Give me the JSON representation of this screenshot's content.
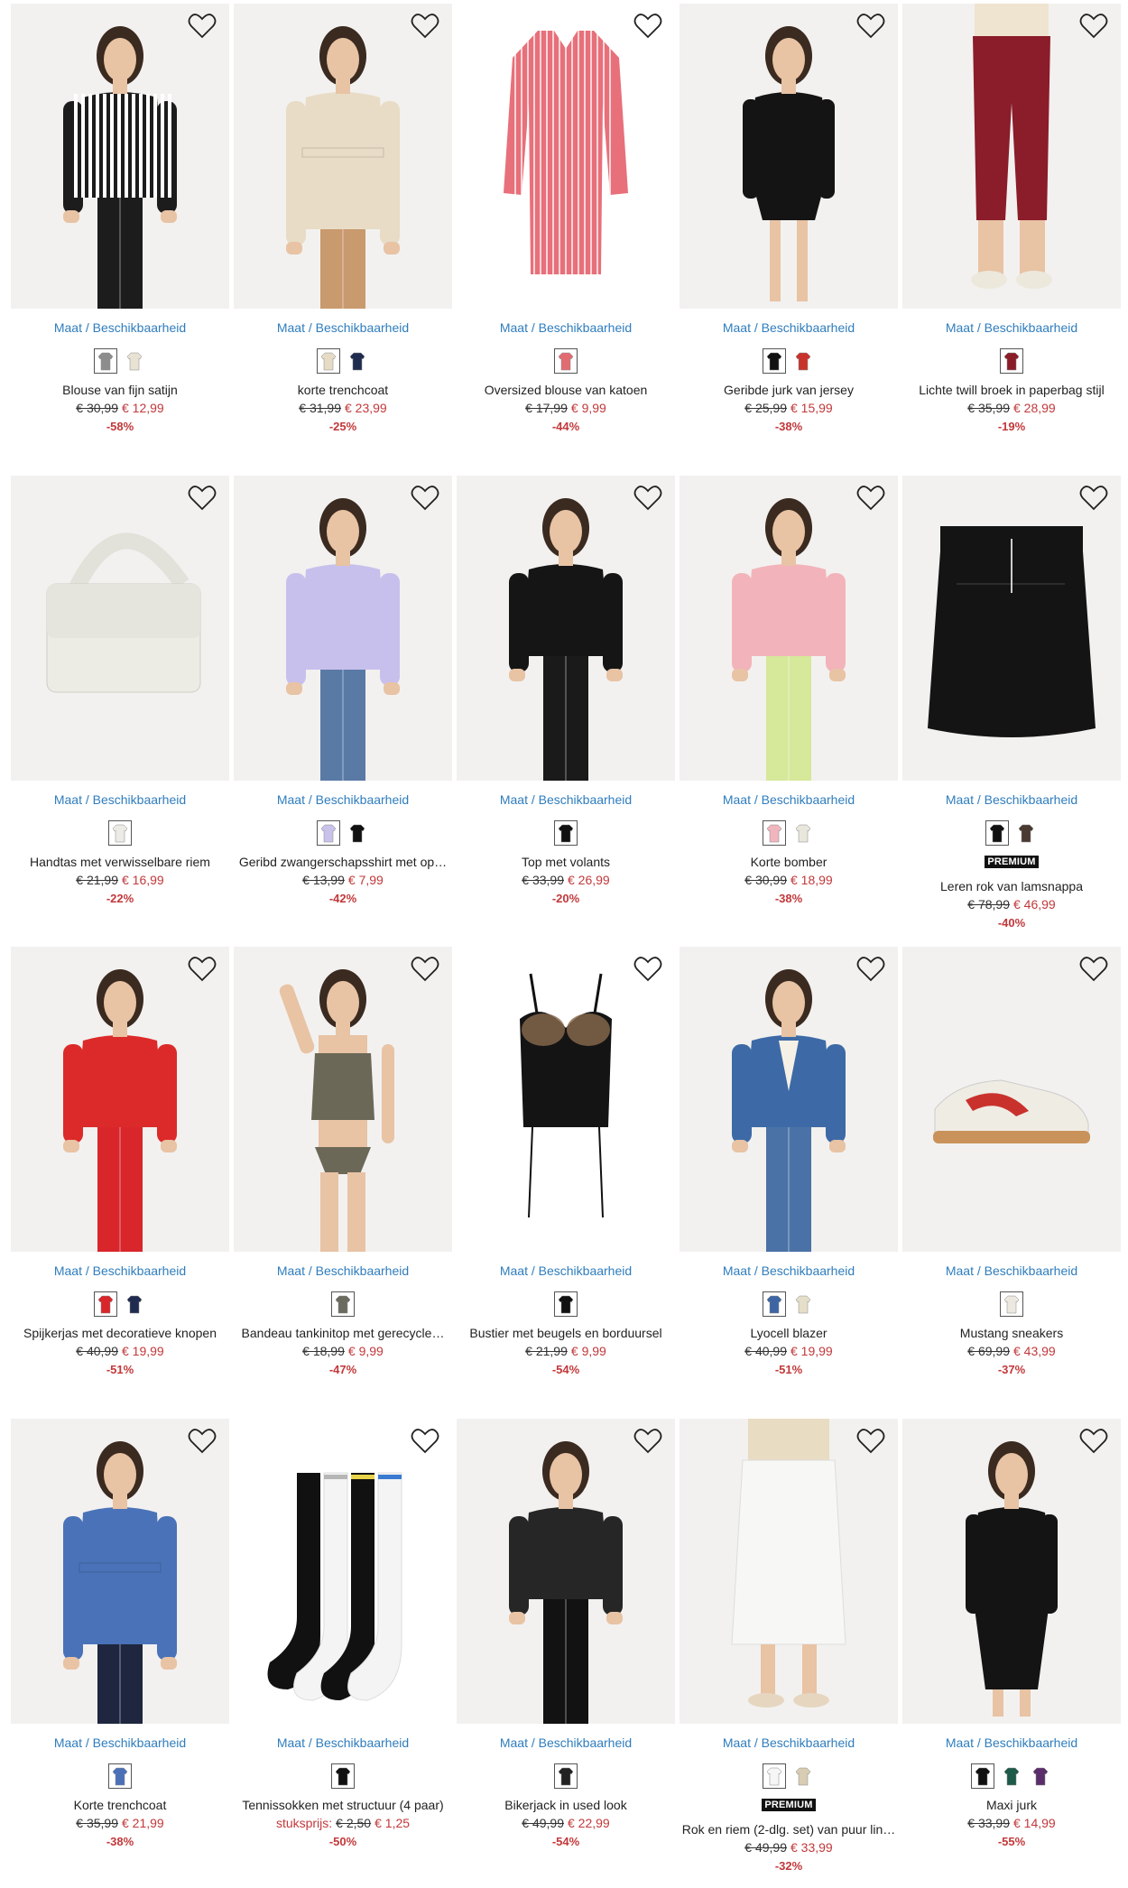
{
  "size_link_label": "Maat / Beschikbaarheid",
  "colors": {
    "link": "#2f7dbd",
    "sale": "#c2383a",
    "badge_bg": "#111111",
    "photo_bg": "#f2f1ef"
  },
  "rows": [
    {
      "products": [
        {
          "name": "Blouse van fijn satijn",
          "old_price": "€ 30,99",
          "new_price": "€ 12,99",
          "discount": "-58%",
          "swatches": [
            {
              "color": "#8d8d8d",
              "selected": true
            },
            {
              "color": "#e7e2d3",
              "selected": false
            }
          ],
          "image": {
            "type": "person",
            "garment": "blouse-striped",
            "top": "#1c1c1c",
            "bottom": "#1c1c1c",
            "bg": "#f2f1ef"
          }
        },
        {
          "name": "korte trenchcoat",
          "old_price": "€ 31,99",
          "new_price": "€ 23,99",
          "discount": "-25%",
          "swatches": [
            {
              "color": "#e6dcc6",
              "selected": true
            },
            {
              "color": "#1f2c4f",
              "selected": false
            }
          ],
          "image": {
            "type": "person",
            "garment": "coat",
            "top": "#e8dcc6",
            "bottom": "#c89a6e",
            "bg": "#f2f1ef"
          }
        },
        {
          "name": "Oversized blouse van katoen",
          "old_price": "€ 17,99",
          "new_price": "€ 9,99",
          "discount": "-44%",
          "swatches": [
            {
              "color": "#e26b72",
              "selected": true
            }
          ],
          "image": {
            "type": "shirt",
            "top": "#e7707a",
            "bg": "#ffffff"
          }
        },
        {
          "name": "Geribde jurk van jersey",
          "old_price": "€ 25,99",
          "new_price": "€ 15,99",
          "discount": "-38%",
          "swatches": [
            {
              "color": "#111111",
              "selected": true
            },
            {
              "color": "#c9322c",
              "selected": false
            }
          ],
          "image": {
            "type": "person",
            "garment": "dress",
            "top": "#141414",
            "bottom": "#141414",
            "bg": "#f2f1ef"
          }
        },
        {
          "name": "Lichte twill broek in paperbag stijl",
          "old_price": "€ 35,99",
          "new_price": "€ 28,99",
          "discount": "-19%",
          "swatches": [
            {
              "color": "#8b1d28",
              "selected": true
            }
          ],
          "image": {
            "type": "legs",
            "bottom": "#8b1c2a",
            "bg": "#f2f1ef"
          }
        }
      ]
    },
    {
      "products": [
        {
          "name": "Handtas met verwisselbare riem",
          "old_price": "€ 21,99",
          "new_price": "€ 16,99",
          "discount": "-22%",
          "swatches": [
            {
              "color": "#ecebe6",
              "selected": true
            }
          ],
          "image": {
            "type": "bag",
            "top": "#ecebe4",
            "bg": "#f2f1ef"
          }
        },
        {
          "name": "Geribd zwangerschapsshirt met op…",
          "old_price": "€ 13,99",
          "new_price": "€ 7,99",
          "discount": "-42%",
          "swatches": [
            {
              "color": "#c9c2ea",
              "selected": true
            },
            {
              "color": "#111111",
              "selected": false
            }
          ],
          "image": {
            "type": "person",
            "garment": "top-long",
            "top": "#c8c0ec",
            "bottom": "#5a7aa6",
            "bg": "#f2f1ef"
          }
        },
        {
          "name": "Top met volants",
          "old_price": "€ 33,99",
          "new_price": "€ 26,99",
          "discount": "-20%",
          "swatches": [
            {
              "color": "#111111",
              "selected": true
            }
          ],
          "image": {
            "type": "person",
            "garment": "top",
            "top": "#151515",
            "bottom": "#1a1a1a",
            "bg": "#f2f1ef"
          }
        },
        {
          "name": "Korte bomber",
          "old_price": "€ 30,99",
          "new_price": "€ 18,99",
          "discount": "-38%",
          "swatches": [
            {
              "color": "#f1b5bd",
              "selected": true
            },
            {
              "color": "#e9e6dc",
              "selected": false
            }
          ],
          "image": {
            "type": "person",
            "garment": "jacket",
            "top": "#f3b3ba",
            "bottom": "#d6e89a",
            "bg": "#f2f1ef"
          }
        },
        {
          "name": "Leren rok van lamsnappa",
          "old_price": "€ 78,99",
          "new_price": "€ 46,99",
          "discount": "-40%",
          "badge": "PREMIUM",
          "swatches": [
            {
              "color": "#111111",
              "selected": true
            },
            {
              "color": "#4a3a32",
              "selected": false
            }
          ],
          "image": {
            "type": "skirt",
            "bottom": "#141414",
            "bg": "#f2f1ef"
          }
        }
      ]
    },
    {
      "products": [
        {
          "name": "Spijkerjas met decoratieve knopen",
          "old_price": "€ 40,99",
          "new_price": "€ 19,99",
          "discount": "-51%",
          "swatches": [
            {
              "color": "#d8262b",
              "selected": true
            },
            {
              "color": "#1f2c4f",
              "selected": false
            }
          ],
          "image": {
            "type": "person",
            "garment": "jacket",
            "top": "#dc2a2a",
            "bottom": "#d8262b",
            "bg": "#f2f1ef"
          }
        },
        {
          "name": "Bandeau tankinitop met gerecycle…",
          "old_price": "€ 18,99",
          "new_price": "€ 9,99",
          "discount": "-47%",
          "swatches": [
            {
              "color": "#6b6a5e",
              "selected": true
            }
          ],
          "image": {
            "type": "person",
            "garment": "swim",
            "top": "#6c6858",
            "bottom": "#6c6858",
            "bg": "#f2f1ef"
          }
        },
        {
          "name": "Bustier met beugels en borduursel",
          "old_price": "€ 21,99",
          "new_price": "€ 9,99",
          "discount": "-54%",
          "swatches": [
            {
              "color": "#111111",
              "selected": true
            }
          ],
          "image": {
            "type": "bustier",
            "top": "#141414",
            "bg": "#ffffff"
          }
        },
        {
          "name": "Lyocell blazer",
          "old_price": "€ 40,99",
          "new_price": "€ 19,99",
          "discount": "-51%",
          "swatches": [
            {
              "color": "#3e65a3",
              "selected": true
            },
            {
              "color": "#e5dfc9",
              "selected": false
            }
          ],
          "image": {
            "type": "person",
            "garment": "blazer",
            "top": "#3d6aa6",
            "bottom": "#4a72a6",
            "bg": "#f2f1ef"
          }
        },
        {
          "name": "Mustang sneakers",
          "old_price": "€ 69,99",
          "new_price": "€ 43,99",
          "discount": "-37%",
          "swatches": [
            {
              "color": "#ece8df",
              "selected": true
            }
          ],
          "image": {
            "type": "sneaker",
            "top": "#efece4",
            "bottom": "#c9322c",
            "bg": "#f2f1ef"
          }
        }
      ]
    },
    {
      "products": [
        {
          "name": "Korte trenchcoat",
          "old_price": "€ 35,99",
          "new_price": "€ 21,99",
          "discount": "-38%",
          "swatches": [
            {
              "color": "#4b70b8",
              "selected": true
            }
          ],
          "image": {
            "type": "person",
            "garment": "coat",
            "top": "#4a72b8",
            "bottom": "#1e2640",
            "bg": "#f2f1ef"
          }
        },
        {
          "name": "Tennissokken met structuur (4 paar)",
          "unit_label": "stuksprijs:",
          "old_price": "€ 2,50",
          "new_price": "€ 1,25",
          "discount": "-50%",
          "swatches": [
            {
              "color": "#111111",
              "selected": true
            }
          ],
          "image": {
            "type": "socks",
            "top": "#111111",
            "bottom": "#f4f4f4",
            "bg": "#ffffff"
          }
        },
        {
          "name": "Bikerjack in used look",
          "old_price": "€ 49,99",
          "new_price": "€ 22,99",
          "discount": "-54%",
          "swatches": [
            {
              "color": "#222222",
              "selected": true
            }
          ],
          "image": {
            "type": "person",
            "garment": "jacket",
            "top": "#262626",
            "bottom": "#121212",
            "bg": "#f2f1ef"
          }
        },
        {
          "name": "Rok en riem (2-dlg. set) van puur lin…",
          "old_price": "€ 49,99",
          "new_price": "€ 33,99",
          "discount": "-32%",
          "badge": "PREMIUM",
          "swatches": [
            {
              "color": "#f6f6f4",
              "selected": true
            },
            {
              "color": "#d8ccb2",
              "selected": false
            }
          ],
          "image": {
            "type": "legs-skirt",
            "top": "#e8dcc2",
            "bottom": "#f7f7f5",
            "bg": "#f2f1ef"
          }
        },
        {
          "name": "Maxi jurk",
          "old_price": "€ 33,99",
          "new_price": "€ 14,99",
          "discount": "-55%",
          "swatches": [
            {
              "color": "#111111",
              "selected": true
            },
            {
              "color": "#1e5a4a",
              "selected": false
            },
            {
              "color": "#5a2e6a",
              "selected": false
            }
          ],
          "image": {
            "type": "person",
            "garment": "maxi",
            "top": "#141414",
            "bottom": "#141414",
            "bg": "#f2f1ef"
          }
        }
      ]
    }
  ]
}
